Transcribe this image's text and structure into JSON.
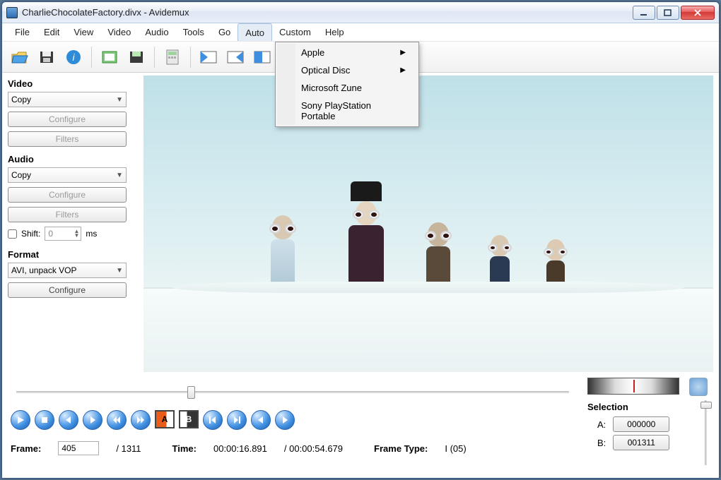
{
  "window": {
    "title": "CharlieChocolateFactory.divx - Avidemux"
  },
  "menu": {
    "items": [
      "File",
      "Edit",
      "View",
      "Video",
      "Audio",
      "Tools",
      "Go",
      "Auto",
      "Custom",
      "Help"
    ],
    "open_index": 7,
    "auto_submenu": [
      {
        "label": "Apple",
        "has_sub": true
      },
      {
        "label": "Optical Disc",
        "has_sub": true
      },
      {
        "label": "Microsoft Zune",
        "has_sub": false
      },
      {
        "label": "Sony PlayStation Portable",
        "has_sub": false
      }
    ]
  },
  "panel": {
    "video": {
      "label": "Video",
      "codec": "Copy",
      "configure": "Configure",
      "filters": "Filters"
    },
    "audio": {
      "label": "Audio",
      "codec": "Copy",
      "configure": "Configure",
      "filters": "Filters",
      "shift_label": "Shift:",
      "shift_value": "0",
      "shift_unit": "ms"
    },
    "format": {
      "label": "Format",
      "container": "AVI, unpack VOP",
      "configure": "Configure"
    }
  },
  "timeline": {
    "position_pct": 31
  },
  "status": {
    "frame_label": "Frame:",
    "frame": "405",
    "frame_total": "/ 1311",
    "time_label": "Time:",
    "time": "00:00:16.891",
    "time_total": "/ 00:00:54.679",
    "frametype_label": "Frame Type:",
    "frametype": "I (05)"
  },
  "selection": {
    "title": "Selection",
    "a_label": "A:",
    "a": "000000",
    "b_label": "B:",
    "b": "001311"
  }
}
